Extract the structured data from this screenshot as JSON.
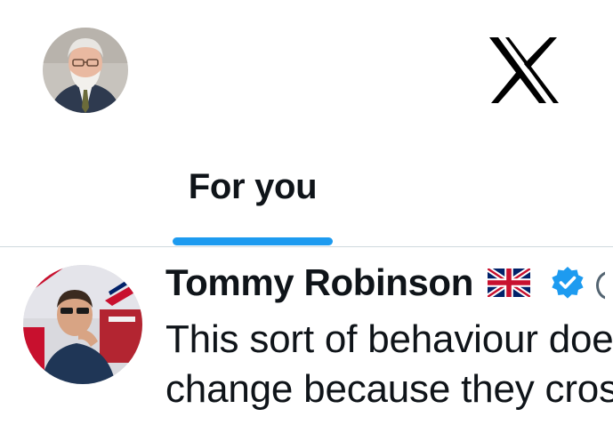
{
  "header": {
    "avatar_icon": "user-avatar-icon",
    "logo_icon": "x-logo-icon"
  },
  "tabs": [
    {
      "label": "For you",
      "active": true
    }
  ],
  "colors": {
    "accent": "#1d9bf0",
    "text_primary": "#0f1419",
    "divider": "#cfd9de",
    "verified": "#1d9bf0"
  },
  "tweet": {
    "author_name": "Tommy Robinson",
    "flag_icon": "uk-flag-icon",
    "verified_icon": "verified-badge-icon",
    "text_lines": [
      "This sort of behaviour doe",
      "change because they cros"
    ]
  }
}
